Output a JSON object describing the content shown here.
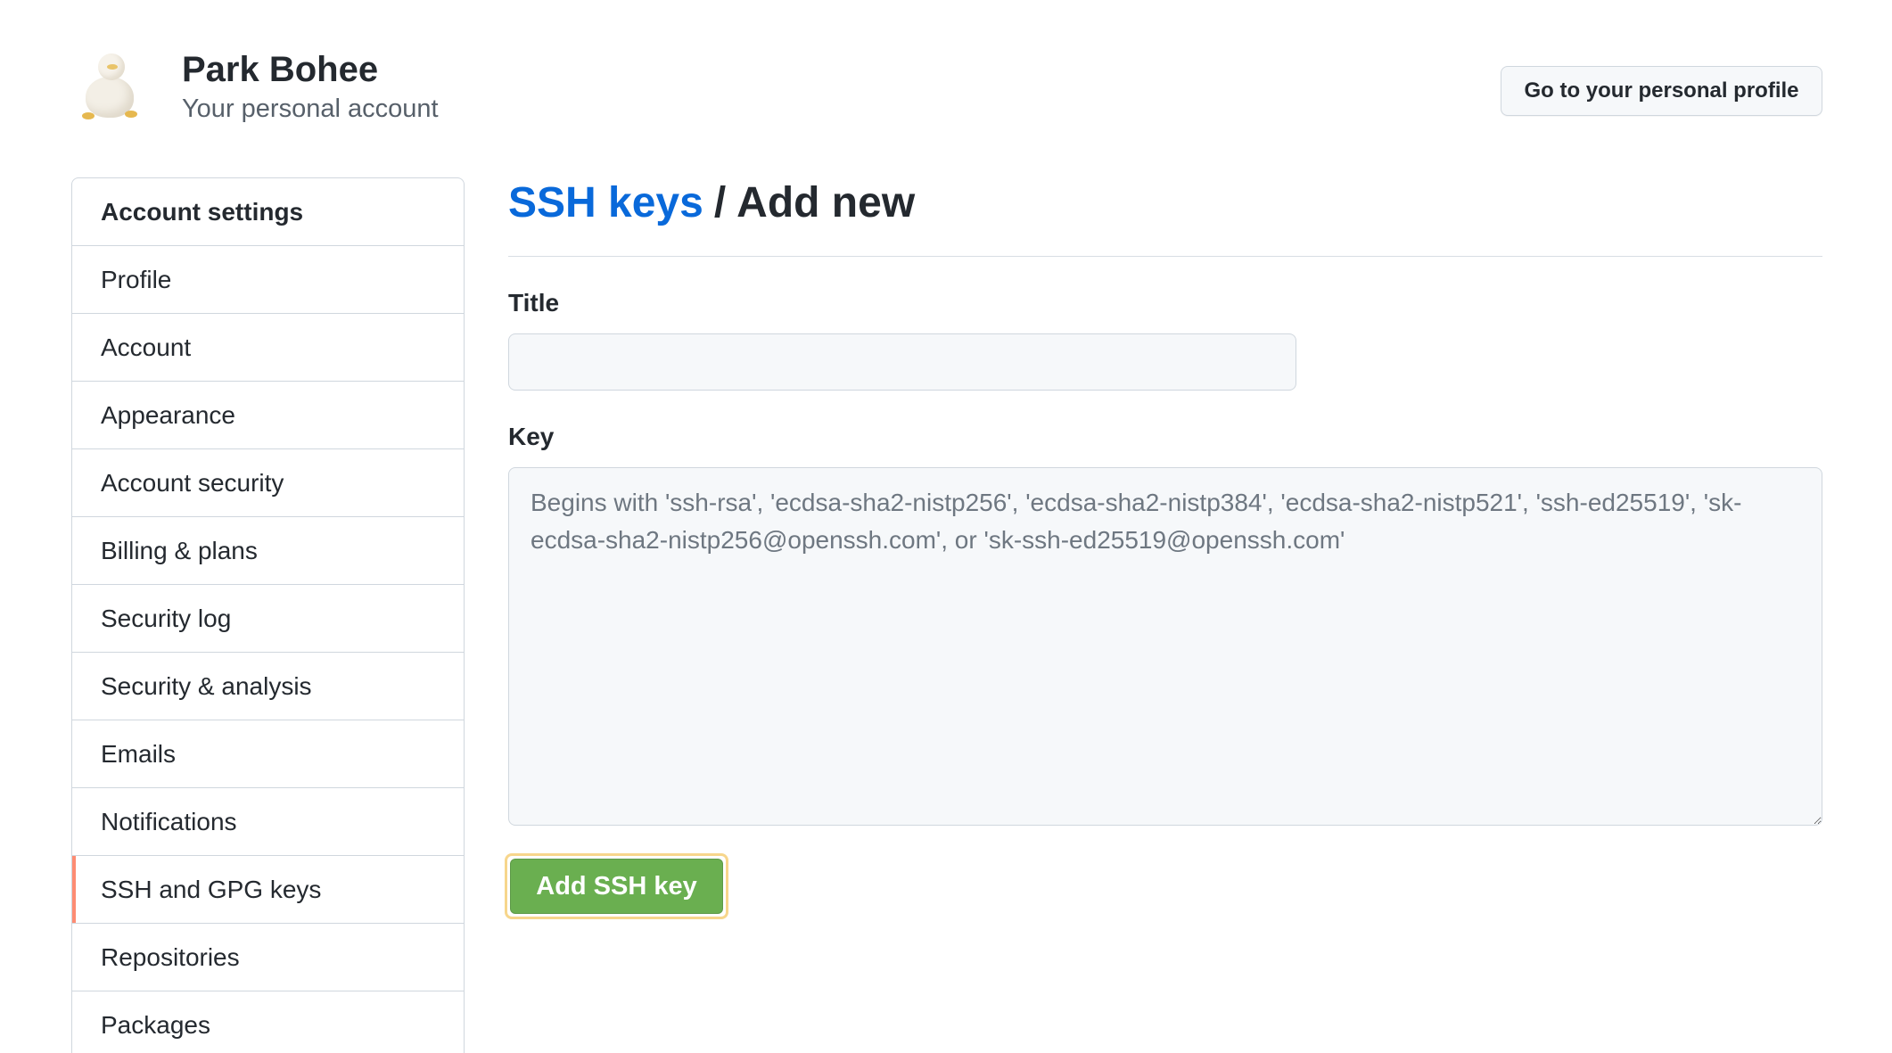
{
  "header": {
    "name": "Park Bohee",
    "subtitle": "Your personal account",
    "profile_button": "Go to your personal profile"
  },
  "sidebar": {
    "heading": "Account settings",
    "items": [
      {
        "label": "Profile"
      },
      {
        "label": "Account"
      },
      {
        "label": "Appearance"
      },
      {
        "label": "Account security"
      },
      {
        "label": "Billing & plans"
      },
      {
        "label": "Security log"
      },
      {
        "label": "Security & analysis"
      },
      {
        "label": "Emails"
      },
      {
        "label": "Notifications"
      },
      {
        "label": "SSH and GPG keys",
        "active": true
      },
      {
        "label": "Repositories"
      },
      {
        "label": "Packages"
      }
    ]
  },
  "main": {
    "breadcrumb_link": "SSH keys",
    "breadcrumb_separator": "/",
    "breadcrumb_current": "Add new",
    "title_label": "Title",
    "title_value": "",
    "key_label": "Key",
    "key_placeholder": "Begins with 'ssh-rsa', 'ecdsa-sha2-nistp256', 'ecdsa-sha2-nistp384', 'ecdsa-sha2-nistp521', 'ssh-ed25519', 'sk-ecdsa-sha2-nistp256@openssh.com', or 'sk-ssh-ed25519@openssh.com'",
    "submit_label": "Add SSH key"
  },
  "colors": {
    "link": "#0969da",
    "primary_button": "#6aaf50",
    "active_indicator": "#fd8c73",
    "highlight_outline": "#f7d68c"
  },
  "icons": {
    "avatar": "duck-plush-avatar"
  }
}
